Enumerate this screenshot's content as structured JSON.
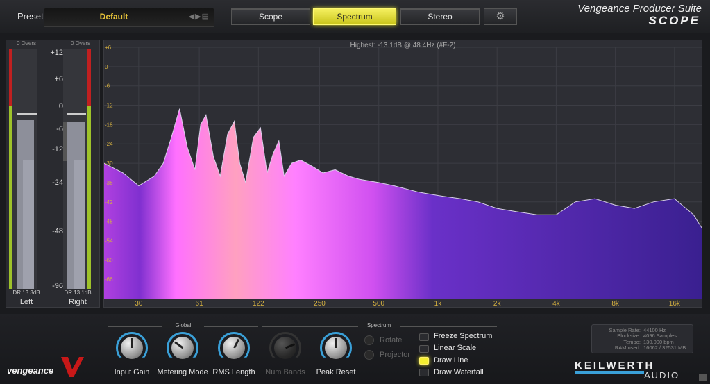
{
  "header": {
    "preset_label": "Preset",
    "preset_name": "Default",
    "preset_nav": "◀▶▤",
    "tabs": [
      {
        "label": "Scope",
        "active": false
      },
      {
        "label": "Spectrum",
        "active": true
      },
      {
        "label": "Stereo",
        "active": false
      }
    ],
    "settings_icon": "gear-icon",
    "settings_glyph": "⚙",
    "brand_line1": "Vengeance Producer Suite",
    "brand_line2": "SCOPE"
  },
  "meters": {
    "left": {
      "overs": "0 Overs",
      "dr": "DR 13.3dB",
      "name": "Left",
      "peak_db": -6,
      "rms_db": -16
    },
    "right": {
      "overs": "0 Overs",
      "dr": "DR 13.1dB",
      "name": "Right",
      "peak_db": -6,
      "rms_db": -16
    },
    "scale": [
      "+12",
      "+6",
      "0",
      "-6",
      "-12",
      "-24",
      "-48",
      "-96"
    ]
  },
  "spectrum": {
    "highest": "Highest: -13.1dB @ 48.4Hz (#F-2)"
  },
  "chart_data": {
    "type": "area",
    "title": "",
    "xlabel": "",
    "ylabel": "",
    "x_scale": "log",
    "xlim": [
      20,
      22000
    ],
    "ylim": [
      -72,
      6
    ],
    "y_ticks": [
      "+6",
      "0",
      "-6",
      "-12",
      "-18",
      "-24",
      "-30",
      "-36",
      "-42",
      "-48",
      "-54",
      "-60",
      "-66"
    ],
    "x_ticks": [
      "30",
      "61",
      "122",
      "250",
      "500",
      "1k",
      "2k",
      "4k",
      "8k",
      "16k"
    ],
    "x_tick_hz": [
      30,
      61,
      122,
      250,
      500,
      1000,
      2000,
      4000,
      8000,
      16000
    ],
    "grid": true,
    "x": [
      20,
      25,
      30,
      36,
      40,
      44,
      48.4,
      53,
      58,
      62,
      66,
      72,
      78,
      85,
      92,
      98,
      105,
      115,
      125,
      135,
      145,
      155,
      165,
      180,
      200,
      230,
      260,
      300,
      350,
      400,
      500,
      600,
      800,
      1000,
      1300,
      1600,
      2000,
      2500,
      3200,
      4000,
      5000,
      6300,
      8000,
      10000,
      12500,
      16000,
      20000,
      22000
    ],
    "y": [
      -30,
      -33,
      -37,
      -34,
      -30,
      -22,
      -13.1,
      -25,
      -32,
      -18,
      -15,
      -28,
      -34,
      -21,
      -17,
      -30,
      -36,
      -22,
      -19,
      -33,
      -27,
      -23,
      -34,
      -30,
      -29,
      -31,
      -33,
      -32,
      -34,
      -35,
      -36,
      -37,
      -39,
      -40,
      -41,
      -42,
      -44,
      -45,
      -46,
      -46,
      -42,
      -41,
      -43,
      -44,
      -42,
      -41,
      -46,
      -50
    ]
  },
  "controls": {
    "global_label": "Global",
    "spectrum_label": "Spectrum",
    "knobs": [
      {
        "label": "Input Gain",
        "enabled": true,
        "value": 0.5
      },
      {
        "label": "Metering Mode",
        "enabled": true,
        "value": 0.3
      },
      {
        "label": "RMS Length",
        "enabled": true,
        "value": 0.6
      },
      {
        "label": "Num Bands",
        "enabled": false,
        "value": 0.75
      },
      {
        "label": "Peak Reset",
        "enabled": true,
        "value": 0.5
      }
    ],
    "radios": [
      {
        "label": "Rotate"
      },
      {
        "label": "Projector"
      }
    ],
    "checks": [
      {
        "label": "Freeze Spectrum",
        "on": false
      },
      {
        "label": "Linear Scale",
        "on": false
      },
      {
        "label": "Draw Line",
        "on": true
      },
      {
        "label": "Draw Waterfall",
        "on": false
      }
    ]
  },
  "info": {
    "rows": [
      {
        "k": "Sample Rate:",
        "v": "44100 Hz"
      },
      {
        "k": "Blocksize:",
        "v": "4096 Samples"
      },
      {
        "k": "Tempo:",
        "v": "130.000 bpm"
      },
      {
        "k": "RAM used:",
        "v": "16062 / 32531 MB"
      }
    ]
  },
  "footer": {
    "vengeance_logo": "vengeance",
    "keilwerth_line1": "KEILWERTH",
    "keilwerth_line2": "AUDIO"
  }
}
